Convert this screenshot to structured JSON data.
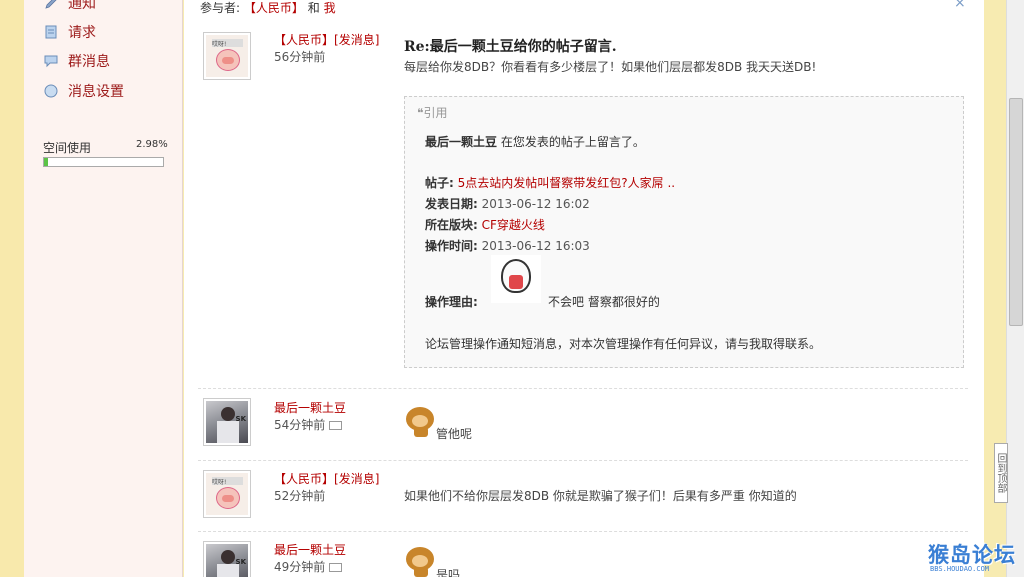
{
  "sidebar": {
    "items": [
      {
        "label": "通知",
        "icon": "pencil-icon"
      },
      {
        "label": "请求",
        "icon": "document-icon"
      },
      {
        "label": "群消息",
        "icon": "chat-icon"
      },
      {
        "label": "消息设置",
        "icon": "globe-icon"
      }
    ],
    "quota": {
      "label": "空间使用",
      "percent_text": "2.98%",
      "percent": 2.98
    }
  },
  "header": {
    "participants_label": "参与者:",
    "participant1": "【人民币】",
    "joiner": "和",
    "participant2": "我",
    "close": "×"
  },
  "messages": [
    {
      "user": "【人民币】",
      "tag": "[发消息]",
      "time": "56分钟前",
      "title": "Re:最后一颗土豆给你的帖子留言.",
      "subtitle": "每层给你发8DB？你看看有多少楼层了！如果他们层层都发8DB 我天天送DB!",
      "quote": {
        "header": "引用",
        "line1_user": "最后一颗土豆",
        "line1_text": " 在您发表的帖子上留言了。",
        "post_label": "帖子:",
        "post_link": "5点去站内发帖叫督察带发红包?人家屌 ..",
        "date_label": "发表日期:",
        "date_value": "2013-06-12 16:02",
        "board_label": "所在版块:",
        "board_link": "CF穿越火线",
        "op_time_label": "操作时间:",
        "op_time_value": "2013-06-12 16:03",
        "reason_label": "操作理由:",
        "reason_text": "不会吧 督察都很好的",
        "footer": "论坛管理操作通知短消息，对本次管理操作有任何异议，请与我取得联系。"
      }
    },
    {
      "user": "最后一颗土豆",
      "time": "54分钟前",
      "text": "管他呢"
    },
    {
      "user": "【人民币】",
      "tag": "[发消息]",
      "time": "52分钟前",
      "text": "如果他们不给你层层发8DB 你就是欺骗了猴子们！后果有多严重 你知道的"
    },
    {
      "user": "最后一颗土豆",
      "time": "49分钟前",
      "text": "是吗"
    }
  ],
  "scroll": {
    "back_to_top": "回到顶部"
  },
  "watermark": {
    "big": "猴岛论坛",
    "small": "BBS.HOUDAO.COM"
  }
}
